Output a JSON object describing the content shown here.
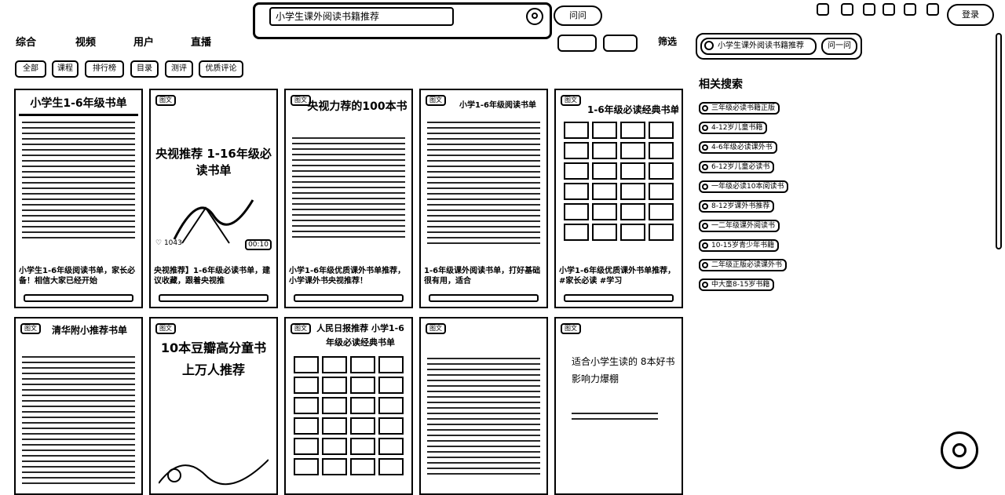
{
  "search": {
    "query": "小学生课外阅读书籍推荐",
    "ask_label": "问问"
  },
  "top_icons": [
    "message-icon",
    "notification-icon",
    "upload-icon",
    "creator-icon",
    "more-icon"
  ],
  "login_label": "登录",
  "tabs": [
    "综合",
    "视频",
    "用户",
    "直播"
  ],
  "chips": [
    "全部",
    "课程",
    "排行榜",
    "目录",
    "测评",
    "优质评论"
  ],
  "tools": {
    "filter_label": "筛选"
  },
  "ai": {
    "query": "小学生课外阅读书籍推荐",
    "ask_label": "问一问"
  },
  "related": {
    "heading": "相关搜索",
    "items": [
      "三年级必读书籍正版",
      "4-12岁儿童书籍",
      "4-6年级必读课外书",
      "6-12岁儿童必读书",
      "一年级必读10本阅读书",
      "8-12岁课外书推荐",
      "一二年级课外阅读书",
      "10-15岁青少年书籍",
      "二年级正版必读课外书",
      "中大童8-15岁书籍"
    ]
  },
  "cards": [
    {
      "title": "小学生1-6年级书单",
      "badge": "",
      "caption": "小学生1-6年级阅读书单，家长必备！相信大家已经开始",
      "likes": "",
      "duration": ""
    },
    {
      "title": "央视推荐 1-16年级必读书单",
      "badge": "图文",
      "caption": "央视推荐】1-6年级必读书单，建议收藏，跟着央视推",
      "likes": "1043",
      "duration": "00:10"
    },
    {
      "title": "央视力荐的100本书",
      "badge": "图文",
      "caption": "小学1-6年级优质课外书单推荐，小学课外书央视推荐！",
      "likes": "",
      "duration": ""
    },
    {
      "title": "小学1-6年级阅读书单",
      "badge": "图文",
      "caption": "1-6年级课外阅读书单，打好基础很有用，适合",
      "likes": "",
      "duration": ""
    },
    {
      "title": "1-6年级必读经典书单",
      "badge": "图文",
      "caption": "小学1-6年级优质课外书单推荐，#家长必读 #学习",
      "likes": "",
      "duration": ""
    },
    {
      "title": "清华附小推荐书单",
      "badge": "图文",
      "caption": "",
      "likes": "",
      "duration": ""
    },
    {
      "title": "10本豆瓣高分童书 上万人推荐",
      "badge": "图文",
      "caption": "",
      "likes": "",
      "duration": ""
    },
    {
      "title": "人民日报推荐 小学1-6年级必读经典书单",
      "badge": "图文",
      "caption": "",
      "likes": "",
      "duration": ""
    },
    {
      "title": "",
      "badge": "图文",
      "caption": "",
      "likes": "",
      "duration": ""
    },
    {
      "title": "适合小学生读的 8本好书 影响力爆棚",
      "badge": "图文",
      "caption": "",
      "likes": "",
      "duration": ""
    }
  ]
}
